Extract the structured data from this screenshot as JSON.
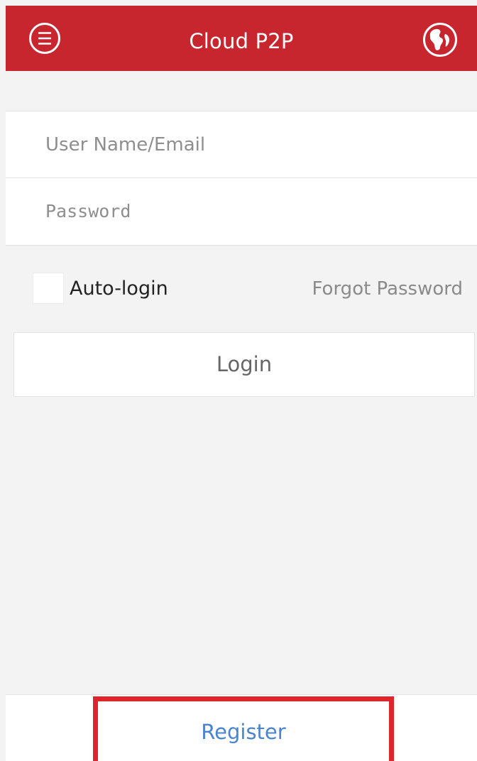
{
  "header": {
    "title": "Cloud P2P",
    "background_color": "#c8262f",
    "menu_icon": "hamburger-circle-icon",
    "globe_icon": "globe-icon"
  },
  "form": {
    "username_placeholder": "User Name/Email",
    "username_value": "",
    "password_placeholder": "Password",
    "password_value": "",
    "autologin_label": "Auto-login",
    "autologin_checked": false,
    "forgot_label": "Forgot Password",
    "login_label": "Login"
  },
  "footer": {
    "register_label": "Register",
    "register_color": "#4a84cf",
    "highlight_color": "#e0242b"
  }
}
